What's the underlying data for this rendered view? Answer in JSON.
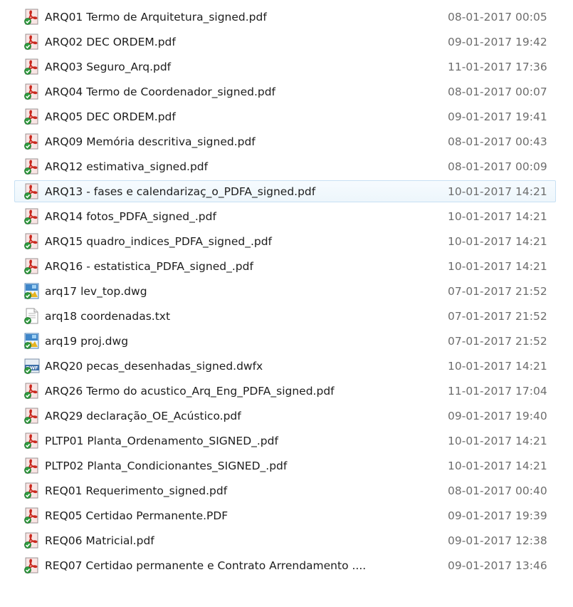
{
  "files": [
    {
      "name": "ARQ01 Termo  de Arquitetura_signed.pdf",
      "date": "08-01-2017 00:05",
      "icon": "pdf-icon"
    },
    {
      "name": "ARQ02 DEC ORDEM.pdf",
      "date": "09-01-2017 19:42",
      "icon": "pdf-icon"
    },
    {
      "name": "ARQ03 Seguro_Arq.pdf",
      "date": "11-01-2017 17:36",
      "icon": "pdf-icon"
    },
    {
      "name": "ARQ04 Termo  de Coordenador_signed.pdf",
      "date": "08-01-2017 00:07",
      "icon": "pdf-icon"
    },
    {
      "name": "ARQ05 DEC ORDEM.pdf",
      "date": "09-01-2017 19:41",
      "icon": "pdf-icon"
    },
    {
      "name": "ARQ09 Memória descritiva_signed.pdf",
      "date": "08-01-2017 00:43",
      "icon": "pdf-icon"
    },
    {
      "name": "ARQ12 estimativa_signed.pdf",
      "date": "08-01-2017 00:09",
      "icon": "pdf-icon"
    },
    {
      "name": "ARQ13 - fases e calendarizaç_o_PDFA_signed.pdf",
      "date": "10-01-2017 14:21",
      "icon": "pdf-icon",
      "selected": true
    },
    {
      "name": "ARQ14 fotos_PDFA_signed_.pdf",
      "date": "10-01-2017 14:21",
      "icon": "pdf-icon"
    },
    {
      "name": "ARQ15 quadro_indices_PDFA_signed_.pdf",
      "date": "10-01-2017 14:21",
      "icon": "pdf-icon"
    },
    {
      "name": "ARQ16 - estatistica_PDFA_signed_.pdf",
      "date": "10-01-2017 14:21",
      "icon": "pdf-icon"
    },
    {
      "name": "arq17 lev_top.dwg",
      "date": "07-01-2017 21:52",
      "icon": "dwg-icon"
    },
    {
      "name": "arq18 coordenadas.txt",
      "date": "07-01-2017 21:52",
      "icon": "txt-icon"
    },
    {
      "name": "arq19 proj.dwg",
      "date": "07-01-2017 21:52",
      "icon": "dwg-icon"
    },
    {
      "name": "ARQ20 pecas_desenhadas_signed.dwfx",
      "date": "10-01-2017 14:21",
      "icon": "dwfx-icon"
    },
    {
      "name": "ARQ26 Termo do acustico_Arq_Eng_PDFA_signed.pdf",
      "date": "11-01-2017 17:04",
      "icon": "pdf-icon"
    },
    {
      "name": "ARQ29  declaração_OE_Acústico.pdf",
      "date": "09-01-2017 19:40",
      "icon": "pdf-icon"
    },
    {
      "name": "PLTP01 Planta_Ordenamento_SIGNED_.pdf",
      "date": "10-01-2017 14:21",
      "icon": "pdf-icon"
    },
    {
      "name": "PLTP02 Planta_Condicionantes_SIGNED_.pdf",
      "date": "10-01-2017 14:21",
      "icon": "pdf-icon"
    },
    {
      "name": "REQ01 Requerimento_signed.pdf",
      "date": "08-01-2017 00:40",
      "icon": "pdf-icon"
    },
    {
      "name": "REQ05 Certidao Permanente.PDF",
      "date": "09-01-2017 19:39",
      "icon": "pdf-icon"
    },
    {
      "name": "REQ06 Matricial.pdf",
      "date": "09-01-2017 12:38",
      "icon": "pdf-icon"
    },
    {
      "name": "REQ07 Certidao permanente e Contrato Arrendamento ....",
      "date": "09-01-2017 13:46",
      "icon": "pdf-icon"
    }
  ],
  "colors": {
    "selection_bg": "#edf6fc",
    "selection_border": "#c7e0f3",
    "date_text": "#6d6d6d"
  }
}
